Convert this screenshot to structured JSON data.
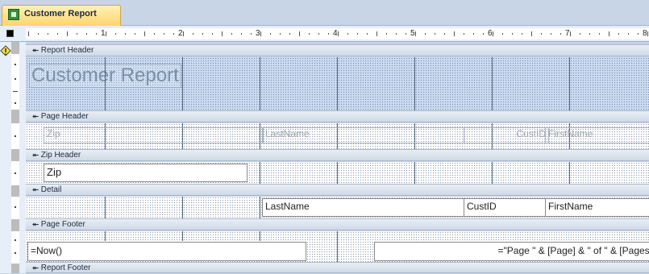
{
  "tab": {
    "title": "Customer Report"
  },
  "ruler": {
    "numbers": [
      "1",
      "2",
      "3",
      "4",
      "5",
      "6",
      "7",
      "8"
    ]
  },
  "sections": {
    "report_header": "Report Header",
    "page_header": "Page Header",
    "zip_header": "Zip Header",
    "detail": "Detail",
    "page_footer": "Page Footer",
    "report_footer": "Report Footer"
  },
  "report_header": {
    "title": "Customer Report"
  },
  "page_header": {
    "zip_label": "Zip",
    "lastname_label": "LastName",
    "custid_label": "CustID",
    "firstname_label": "FirstName"
  },
  "zip_header": {
    "zip_field": "Zip"
  },
  "detail": {
    "lastname_field": "LastName",
    "custid_field": "CustID",
    "firstname_field": "FirstName"
  },
  "page_footer": {
    "now_field": "=Now()",
    "page_field": "=\"Page \" & [Page] & \" of \" & [Pages]"
  },
  "colors": {
    "selected_section": "#c9daf0",
    "tab_active": "#ffd56b"
  }
}
